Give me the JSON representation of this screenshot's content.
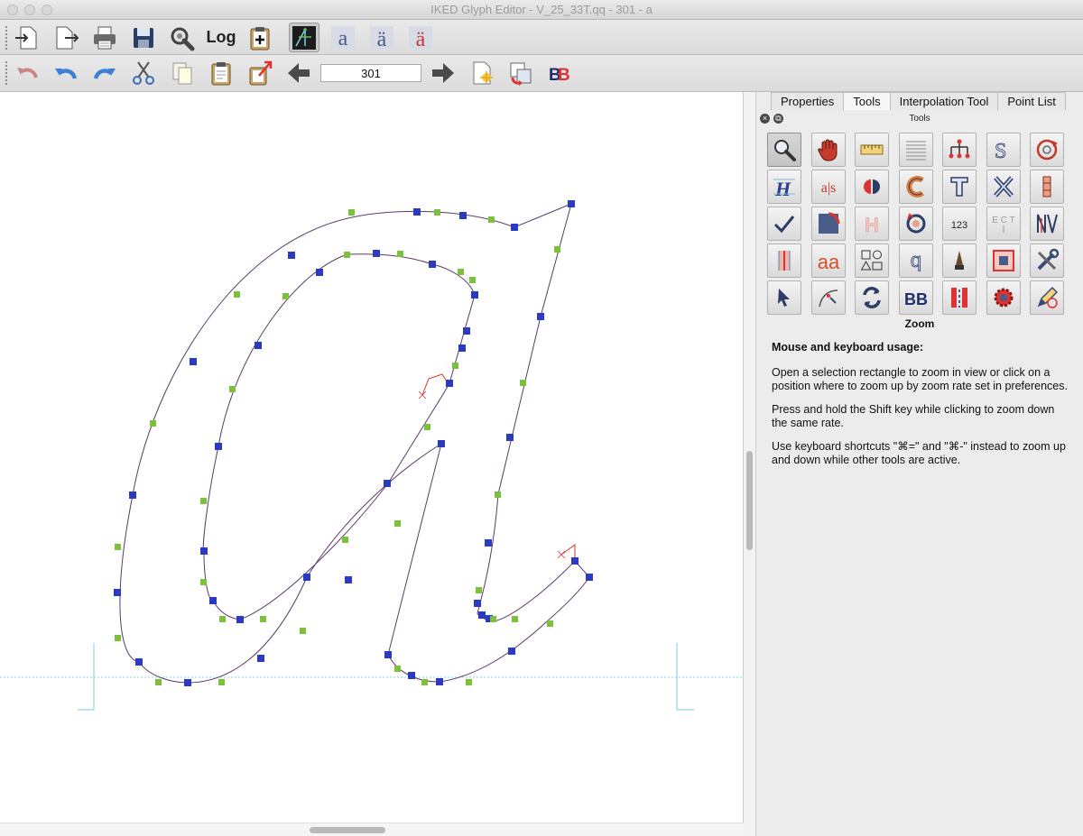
{
  "window": {
    "title": "IKED Glyph Editor - V_25_33T.qq - 301 - a"
  },
  "toolbar1": {
    "log_label": "Log",
    "buttons": [
      "import-icon",
      "export-icon",
      "print-icon",
      "save-icon",
      "settings-wrench-icon",
      "log-icon",
      "clipboard-add-icon",
      "outline-view-icon",
      "glyph-a-icon",
      "glyph-a-umlaut-icon",
      "glyph-a-umlaut-red-icon"
    ]
  },
  "toolbar2": {
    "page_value": "301",
    "buttons": [
      "undo-disabled-icon",
      "undo-icon",
      "redo-icon",
      "cut-icon",
      "copy-icon",
      "paste-icon",
      "paste-special-icon",
      "prev-arrow-icon",
      "next-arrow-icon",
      "new-page-icon",
      "transfer-icon",
      "bb-icon"
    ]
  },
  "panel": {
    "tabs": [
      "Properties",
      "Tools",
      "Interpolation Tool",
      "Point List"
    ],
    "active_tab": "Tools",
    "dock_title": "Tools",
    "tool_texts": {
      "as": "a|s",
      "num": "123",
      "ect": "E C T",
      "aa": "aa",
      "q": "q",
      "bb": "BB",
      "s": "S"
    },
    "selected_tool_name": "Zoom",
    "help_heading": "Mouse and keyboard usage:",
    "help_paragraphs": [
      "Open a selection rectangle to zoom in view or click on a position where to zoom up by zoom rate set in preferences.",
      "Press and hold the Shift key while clicking to zoom down the same rate.",
      "Use keyboard shortcuts \"⌘=\" and \"⌘-\" instead to zoom up and down while other tools are active."
    ]
  },
  "colors": {
    "on_curve_point": "#2a3bc1",
    "off_curve_point": "#7cc13a",
    "outline": "#5a3a6a",
    "metric_line": "#7fcadc",
    "accent_red": "#e0332b"
  }
}
